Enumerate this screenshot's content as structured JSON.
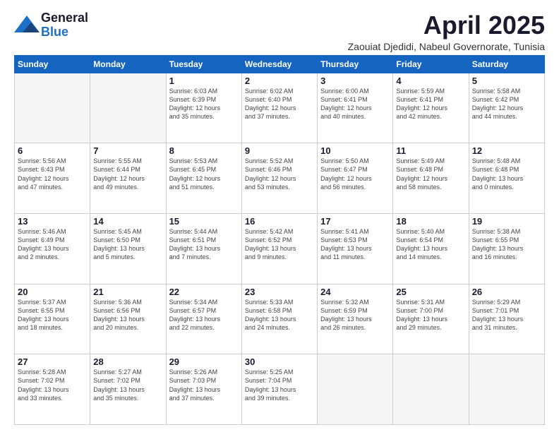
{
  "logo": {
    "general": "General",
    "blue": "Blue"
  },
  "title": "April 2025",
  "subtitle": "Zaouiat Djedidi, Nabeul Governorate, Tunisia",
  "headers": [
    "Sunday",
    "Monday",
    "Tuesday",
    "Wednesday",
    "Thursday",
    "Friday",
    "Saturday"
  ],
  "weeks": [
    [
      {
        "day": "",
        "info": ""
      },
      {
        "day": "",
        "info": ""
      },
      {
        "day": "1",
        "info": "Sunrise: 6:03 AM\nSunset: 6:39 PM\nDaylight: 12 hours\nand 35 minutes."
      },
      {
        "day": "2",
        "info": "Sunrise: 6:02 AM\nSunset: 6:40 PM\nDaylight: 12 hours\nand 37 minutes."
      },
      {
        "day": "3",
        "info": "Sunrise: 6:00 AM\nSunset: 6:41 PM\nDaylight: 12 hours\nand 40 minutes."
      },
      {
        "day": "4",
        "info": "Sunrise: 5:59 AM\nSunset: 6:41 PM\nDaylight: 12 hours\nand 42 minutes."
      },
      {
        "day": "5",
        "info": "Sunrise: 5:58 AM\nSunset: 6:42 PM\nDaylight: 12 hours\nand 44 minutes."
      }
    ],
    [
      {
        "day": "6",
        "info": "Sunrise: 5:56 AM\nSunset: 6:43 PM\nDaylight: 12 hours\nand 47 minutes."
      },
      {
        "day": "7",
        "info": "Sunrise: 5:55 AM\nSunset: 6:44 PM\nDaylight: 12 hours\nand 49 minutes."
      },
      {
        "day": "8",
        "info": "Sunrise: 5:53 AM\nSunset: 6:45 PM\nDaylight: 12 hours\nand 51 minutes."
      },
      {
        "day": "9",
        "info": "Sunrise: 5:52 AM\nSunset: 6:46 PM\nDaylight: 12 hours\nand 53 minutes."
      },
      {
        "day": "10",
        "info": "Sunrise: 5:50 AM\nSunset: 6:47 PM\nDaylight: 12 hours\nand 56 minutes."
      },
      {
        "day": "11",
        "info": "Sunrise: 5:49 AM\nSunset: 6:48 PM\nDaylight: 12 hours\nand 58 minutes."
      },
      {
        "day": "12",
        "info": "Sunrise: 5:48 AM\nSunset: 6:48 PM\nDaylight: 13 hours\nand 0 minutes."
      }
    ],
    [
      {
        "day": "13",
        "info": "Sunrise: 5:46 AM\nSunset: 6:49 PM\nDaylight: 13 hours\nand 2 minutes."
      },
      {
        "day": "14",
        "info": "Sunrise: 5:45 AM\nSunset: 6:50 PM\nDaylight: 13 hours\nand 5 minutes."
      },
      {
        "day": "15",
        "info": "Sunrise: 5:44 AM\nSunset: 6:51 PM\nDaylight: 13 hours\nand 7 minutes."
      },
      {
        "day": "16",
        "info": "Sunrise: 5:42 AM\nSunset: 6:52 PM\nDaylight: 13 hours\nand 9 minutes."
      },
      {
        "day": "17",
        "info": "Sunrise: 5:41 AM\nSunset: 6:53 PM\nDaylight: 13 hours\nand 11 minutes."
      },
      {
        "day": "18",
        "info": "Sunrise: 5:40 AM\nSunset: 6:54 PM\nDaylight: 13 hours\nand 14 minutes."
      },
      {
        "day": "19",
        "info": "Sunrise: 5:38 AM\nSunset: 6:55 PM\nDaylight: 13 hours\nand 16 minutes."
      }
    ],
    [
      {
        "day": "20",
        "info": "Sunrise: 5:37 AM\nSunset: 6:55 PM\nDaylight: 13 hours\nand 18 minutes."
      },
      {
        "day": "21",
        "info": "Sunrise: 5:36 AM\nSunset: 6:56 PM\nDaylight: 13 hours\nand 20 minutes."
      },
      {
        "day": "22",
        "info": "Sunrise: 5:34 AM\nSunset: 6:57 PM\nDaylight: 13 hours\nand 22 minutes."
      },
      {
        "day": "23",
        "info": "Sunrise: 5:33 AM\nSunset: 6:58 PM\nDaylight: 13 hours\nand 24 minutes."
      },
      {
        "day": "24",
        "info": "Sunrise: 5:32 AM\nSunset: 6:59 PM\nDaylight: 13 hours\nand 26 minutes."
      },
      {
        "day": "25",
        "info": "Sunrise: 5:31 AM\nSunset: 7:00 PM\nDaylight: 13 hours\nand 29 minutes."
      },
      {
        "day": "26",
        "info": "Sunrise: 5:29 AM\nSunset: 7:01 PM\nDaylight: 13 hours\nand 31 minutes."
      }
    ],
    [
      {
        "day": "27",
        "info": "Sunrise: 5:28 AM\nSunset: 7:02 PM\nDaylight: 13 hours\nand 33 minutes."
      },
      {
        "day": "28",
        "info": "Sunrise: 5:27 AM\nSunset: 7:02 PM\nDaylight: 13 hours\nand 35 minutes."
      },
      {
        "day": "29",
        "info": "Sunrise: 5:26 AM\nSunset: 7:03 PM\nDaylight: 13 hours\nand 37 minutes."
      },
      {
        "day": "30",
        "info": "Sunrise: 5:25 AM\nSunset: 7:04 PM\nDaylight: 13 hours\nand 39 minutes."
      },
      {
        "day": "",
        "info": ""
      },
      {
        "day": "",
        "info": ""
      },
      {
        "day": "",
        "info": ""
      }
    ]
  ]
}
